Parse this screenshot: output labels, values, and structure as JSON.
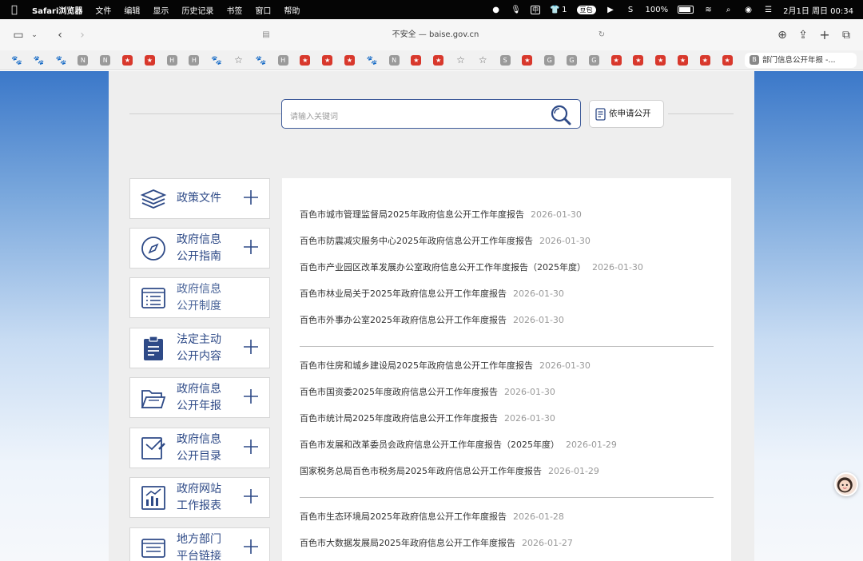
{
  "menubar": {
    "app_name": "Safari浏览器",
    "menus": [
      "文件",
      "编辑",
      "显示",
      "历史记录",
      "书签",
      "窗口",
      "帮助"
    ],
    "input_method": "中",
    "shirt_count": "1",
    "badge": "豆包",
    "battery": "100%",
    "datetime": "2月1日 周日  00:34"
  },
  "browser": {
    "url": "不安全 — baise.gov.cn",
    "tab_title": "部门信息公开年报 -...",
    "tab_favicon": "B",
    "favorites": [
      {
        "kind": "paw"
      },
      {
        "kind": "paw"
      },
      {
        "kind": "paw"
      },
      {
        "kind": "gray",
        "letter": "N"
      },
      {
        "kind": "gray",
        "letter": "N"
      },
      {
        "kind": "red"
      },
      {
        "kind": "red"
      },
      {
        "kind": "gray",
        "letter": "H"
      },
      {
        "kind": "gray",
        "letter": "H"
      },
      {
        "kind": "paw"
      },
      {
        "kind": "star"
      },
      {
        "kind": "paw"
      },
      {
        "kind": "gray",
        "letter": "H"
      },
      {
        "kind": "red"
      },
      {
        "kind": "red"
      },
      {
        "kind": "red"
      },
      {
        "kind": "paw"
      },
      {
        "kind": "gray",
        "letter": "N"
      },
      {
        "kind": "red"
      },
      {
        "kind": "red"
      },
      {
        "kind": "star"
      },
      {
        "kind": "star"
      },
      {
        "kind": "gray",
        "letter": "S"
      },
      {
        "kind": "red"
      },
      {
        "kind": "gray",
        "letter": "G"
      },
      {
        "kind": "gray",
        "letter": "G"
      },
      {
        "kind": "gray",
        "letter": "G"
      },
      {
        "kind": "red"
      },
      {
        "kind": "red"
      },
      {
        "kind": "red"
      },
      {
        "kind": "red"
      },
      {
        "kind": "red"
      },
      {
        "kind": "red"
      }
    ]
  },
  "search": {
    "placeholder": "请输入关键词",
    "apply_label": "依申请公开"
  },
  "sidebar": {
    "items": [
      {
        "line1": "政策文件",
        "line2": "",
        "icon": "layers-icon"
      },
      {
        "line1": "政府信息",
        "line2": "公开指南",
        "icon": "compass-icon"
      },
      {
        "line1": "政府信息",
        "line2": "公开制度",
        "icon": "list-document-icon"
      },
      {
        "line1": "法定主动",
        "line2": "公开内容",
        "icon": "clipboard-icon"
      },
      {
        "line1": "政府信息",
        "line2": "公开年报",
        "icon": "folder-icon"
      },
      {
        "line1": "政府信息",
        "line2": "公开目录",
        "icon": "edit-document-icon"
      },
      {
        "line1": "政府网站",
        "line2": "工作报表",
        "icon": "chart-icon"
      },
      {
        "line1": "地方部门",
        "line2": "平台链接",
        "icon": "browser-icon"
      }
    ]
  },
  "reports": {
    "group1": [
      {
        "title": "百色市城市管理监督局2025年政府信息公开工作年度报告",
        "date": "2026-01-30"
      },
      {
        "title": "百色市防震减灾服务中心2025年政府信息公开工作年度报告",
        "date": "2026-01-30"
      },
      {
        "title": "百色市产业园区改革发展办公室政府信息公开工作年度报告（2025年度）",
        "date": "2026-01-30"
      },
      {
        "title": "百色市林业局关于2025年政府信息公开工作年度报告",
        "date": "2026-01-30"
      },
      {
        "title": "百色市外事办公室2025年政府信息公开工作年度报告",
        "date": "2026-01-30"
      }
    ],
    "group2": [
      {
        "title": "百色市住房和城乡建设局2025年政府信息公开工作年度报告",
        "date": "2026-01-30"
      },
      {
        "title": "百色市国资委2025年度政府信息公开工作年度报告",
        "date": "2026-01-30"
      },
      {
        "title": "百色市统计局2025年度政府信息公开工作年度报告",
        "date": "2026-01-30"
      },
      {
        "title": "百色市发展和改革委员会政府信息公开工作年度报告（2025年度）",
        "date": "2026-01-29"
      },
      {
        "title": "国家税务总局百色市税务局2025年政府信息公开工作年度报告",
        "date": "2026-01-29"
      }
    ],
    "group3": [
      {
        "title": "百色市生态环境局2025年政府信息公开工作年度报告",
        "date": "2026-01-28"
      },
      {
        "title": "百色市大数据发展局2025年政府信息公开工作年度报告",
        "date": "2026-01-27"
      }
    ]
  }
}
